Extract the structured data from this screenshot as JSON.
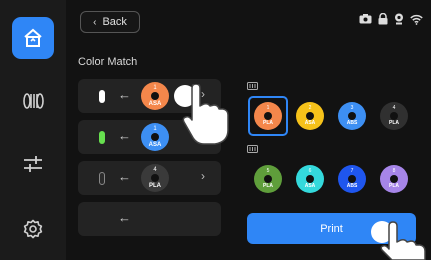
{
  "header": {
    "back_label": "Back"
  },
  "section": {
    "title": "Color Match"
  },
  "rows": [
    {
      "index": 0,
      "label": "1",
      "material": "ASA",
      "color": "#f4874b",
      "filament_color": "#ffffff"
    },
    {
      "index": 1,
      "label": "1",
      "material": "ASA",
      "color": "#3d8ff3",
      "filament_color": "#67e04f"
    },
    {
      "index": 2,
      "label": "4",
      "material": "PLA",
      "color": "#3a3a3a",
      "filament_color": "#2b2b2b"
    },
    {
      "index": 3,
      "label": "",
      "material": "",
      "color": "",
      "filament_color": ""
    }
  ],
  "groups": [
    {
      "slots": [
        {
          "label": "1",
          "material": "PLA",
          "color": "#f4874b",
          "selected": true
        },
        {
          "label": "2",
          "material": "ASA",
          "color": "#f6c21a",
          "selected": false
        },
        {
          "label": "3",
          "material": "ABS",
          "color": "#3d8ff3",
          "selected": false
        },
        {
          "label": "4",
          "material": "PLA",
          "color": "#303030",
          "selected": false
        }
      ]
    },
    {
      "slots": [
        {
          "label": "5",
          "material": "PLA",
          "color": "#5f9e3b",
          "selected": false
        },
        {
          "label": "6",
          "material": "ASA",
          "color": "#34d9dc",
          "selected": false
        },
        {
          "label": "7",
          "material": "ABS",
          "color": "#1f56ee",
          "selected": false
        },
        {
          "label": "8",
          "material": "PLA",
          "color": "#a685e8",
          "selected": false
        }
      ]
    }
  ],
  "print": {
    "label": "Print"
  },
  "icons": {
    "sidebar": [
      "home-printer-icon",
      "filament-spool-icon",
      "sliders-icon",
      "settings-gear-icon"
    ],
    "status": [
      "camera-icon",
      "lock-icon",
      "notification-icon",
      "wifi-icon"
    ]
  },
  "colors": {
    "accent": "#2f86f6",
    "background": "#121212",
    "sidebar": "#1b1b1b",
    "card": "#232323"
  }
}
